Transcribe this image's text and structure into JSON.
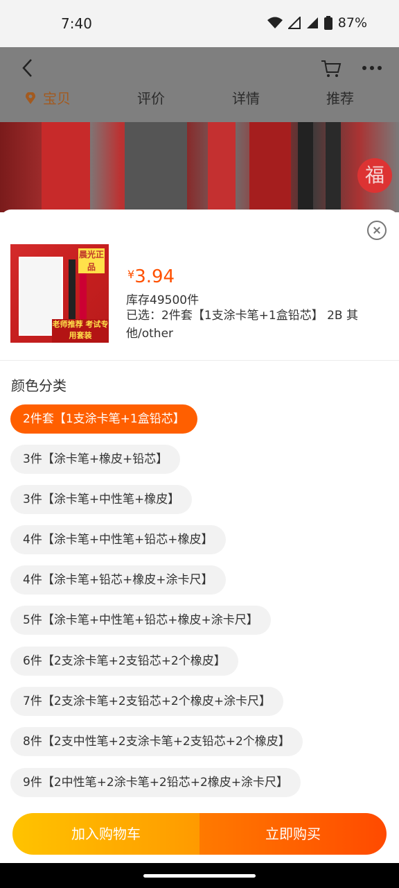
{
  "status": {
    "time": "7:40",
    "battery": "87%"
  },
  "tabs": [
    {
      "label": "宝贝",
      "active": true
    },
    {
      "label": "评价"
    },
    {
      "label": "详情"
    },
    {
      "label": "推荐"
    }
  ],
  "product": {
    "image_badge_top": "晨光正品",
    "image_badge_bottom": "老师推荐 考试专用套装",
    "price_symbol": "¥",
    "price": "3.94",
    "stock": "库存49500件",
    "selected": "已选：2件套【1支涂卡笔+1盒铅芯】 2B 其他/other"
  },
  "section_title": "颜色分类",
  "options": [
    {
      "label": "2件套【1支涂卡笔+1盒铅芯】",
      "selected": true
    },
    {
      "label": "3件【涂卡笔+橡皮+铅芯】"
    },
    {
      "label": "3件【涂卡笔+中性笔+橡皮】"
    },
    {
      "label": "4件【涂卡笔+中性笔+铅芯+橡皮】"
    },
    {
      "label": "4件【涂卡笔+铅芯+橡皮+涂卡尺】"
    },
    {
      "label": "5件【涂卡笔+中性笔+铅芯+橡皮+涂卡尺】"
    },
    {
      "label": "6件【2支涂卡笔+2支铅芯+2个橡皮】"
    },
    {
      "label": "7件【2支涂卡笔+2支铅芯+2个橡皮+涂卡尺】"
    },
    {
      "label": "8件【2支中性笔+2支涂卡笔+2支铅芯+2个橡皮】"
    },
    {
      "label": "9件【2中性笔+2涂卡笔+2铅芯+2橡皮+涂卡尺】"
    }
  ],
  "buttons": {
    "add_to_cart": "加入购物车",
    "buy_now": "立即购买"
  },
  "colors": {
    "accent": "#ff5000",
    "cart_button": "#ffb300",
    "buy_button": "#ff5a00"
  }
}
